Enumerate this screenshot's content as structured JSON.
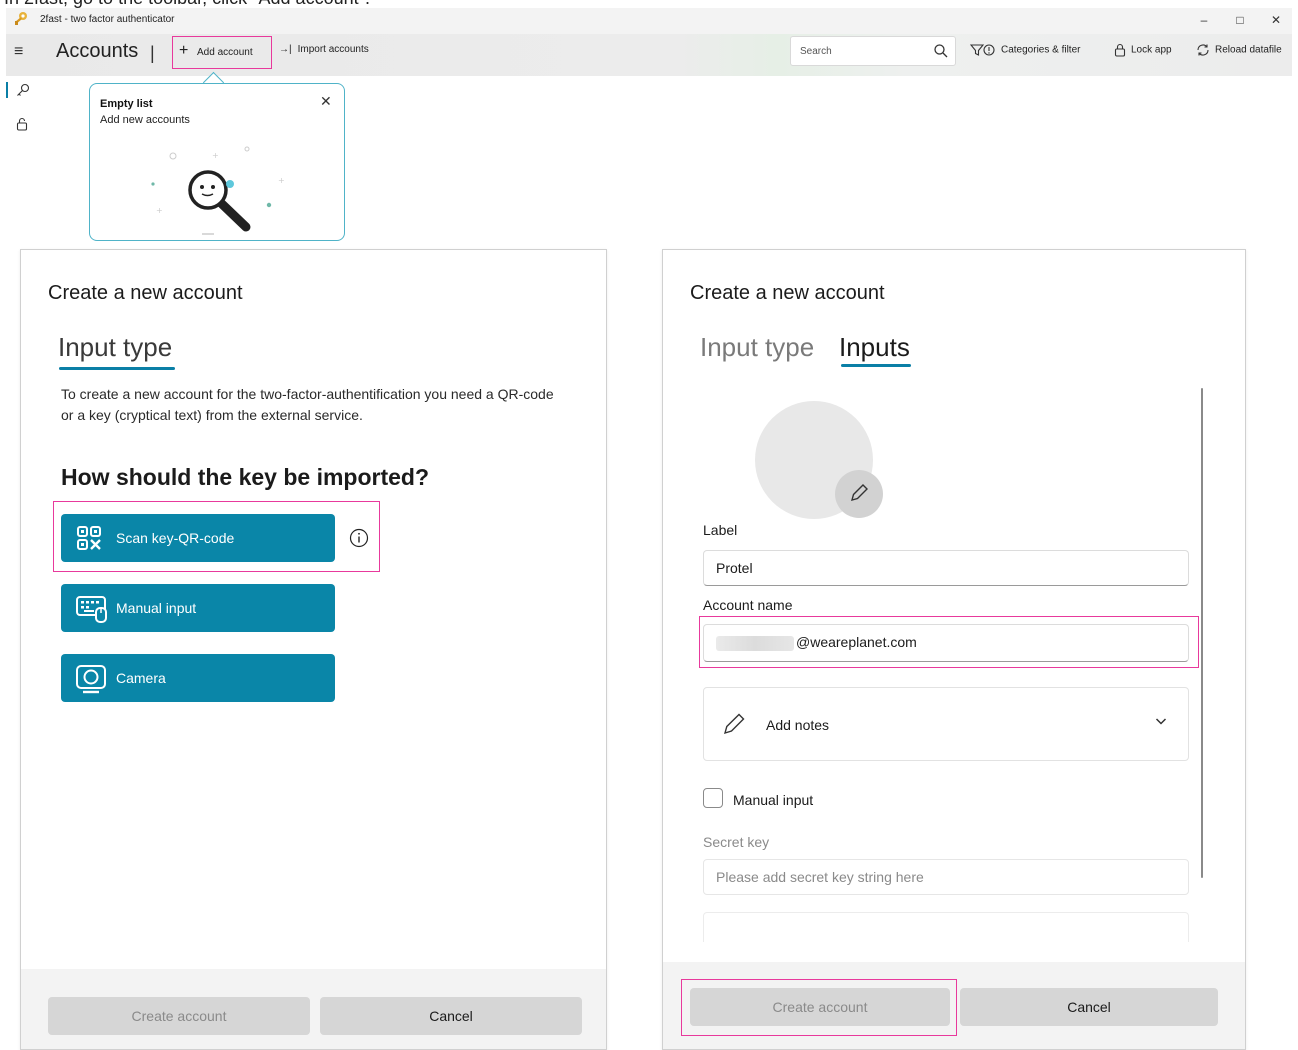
{
  "caption": "In 2fast, go to the toolbar, click \"Add account\".",
  "app": {
    "title": "2fast - two factor authenticator",
    "page_title": "Accounts",
    "separator": "|"
  },
  "toolbar": {
    "add_account": "Add account",
    "import_accounts": "Import accounts",
    "search_placeholder": "Search",
    "categories_filter": "Categories & filter",
    "lock_app": "Lock app",
    "reload_datafile": "Reload datafile"
  },
  "teaching_tip": {
    "title": "Empty list",
    "text": "Add new accounts"
  },
  "dialog_left": {
    "title": "Create a new account",
    "tab": "Input type",
    "description": "To create a new account for the two-factor-authentification you need a QR-code or a key (cryptical text) from the external service.",
    "question": "How should the key be imported?",
    "options": {
      "scan": "Scan key-QR-code",
      "manual": "Manual input",
      "camera": "Camera"
    },
    "create_button": "Create account",
    "cancel_button": "Cancel"
  },
  "dialog_right": {
    "title": "Create a new account",
    "tabs": [
      "Input type",
      "Inputs"
    ],
    "label_label": "Label",
    "label_value": "Protel",
    "account_name_label": "Account name",
    "account_name_value": "@weareplanet.com",
    "add_notes": "Add notes",
    "manual_input_label": "Manual input",
    "manual_input_checked": false,
    "secret_key_label": "Secret key",
    "secret_key_placeholder": "Please add secret key string here",
    "create_button": "Create account",
    "cancel_button": "Cancel"
  },
  "colors": {
    "accent": "#0a86a8",
    "highlight": "#e8399c",
    "tip_border": "#4fb3c8"
  },
  "icons": [
    "app-logo-icon",
    "hamburger-icon",
    "plus-icon",
    "import-arrow-icon",
    "search-icon",
    "filter-icon",
    "lock-icon",
    "reload-icon",
    "key-icon",
    "close-icon",
    "qr-code-icon",
    "keyboard-icon",
    "camera-icon",
    "info-icon",
    "pencil-icon",
    "chevron-down-icon"
  ]
}
